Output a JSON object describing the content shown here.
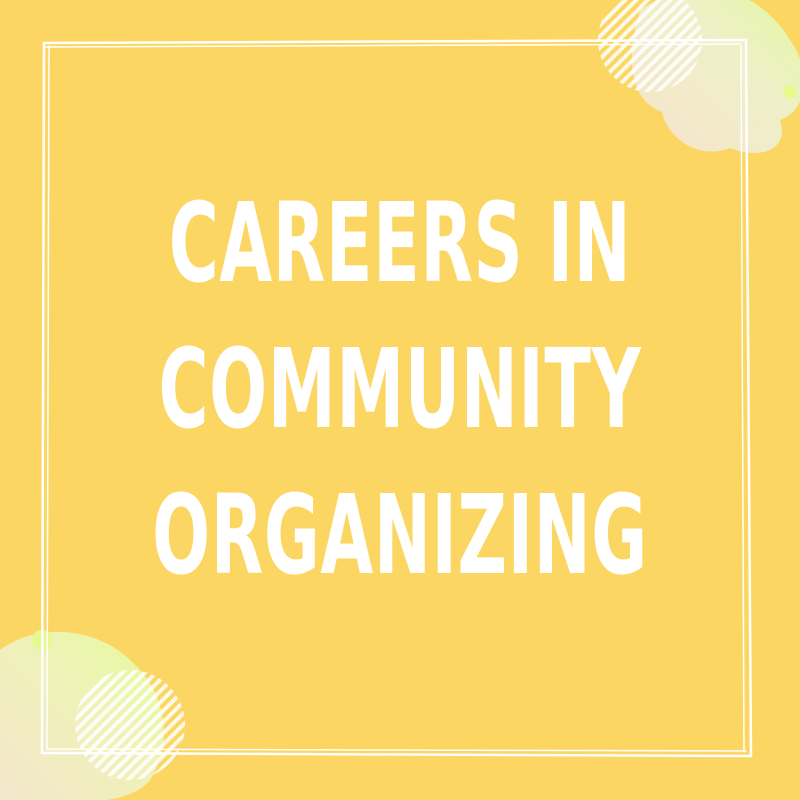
{
  "title": {
    "lines": [
      "CAREERS IN",
      "COMMUNITY",
      "ORGANIZING"
    ]
  },
  "colors": {
    "background": "#fcd662",
    "text": "#ffffff",
    "frame": "#ffffff",
    "blob_gradient": [
      "#f8e7c8",
      "#f0ead0",
      "#e2f99a"
    ]
  },
  "decor": {
    "frame": "hand-drawn-double-line-frame",
    "corner_top_right": "pastel-blob-with-striped-circle",
    "corner_bottom_left": "pastel-blob-with-striped-circle"
  }
}
